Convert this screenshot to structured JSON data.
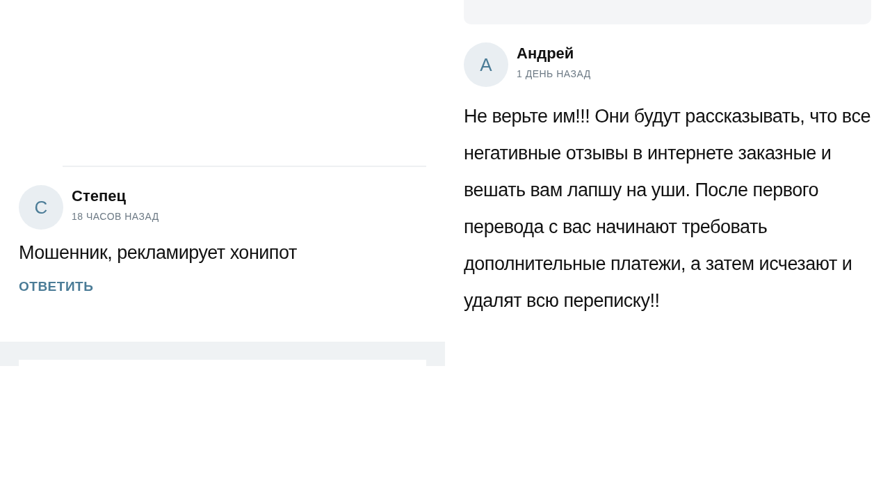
{
  "comments": [
    {
      "avatar_letter": "С",
      "author": "Степец",
      "time": "18 ЧАСОВ НАЗАД",
      "text": "Мошенник, рекламирует хонипот",
      "reply": "ОТВЕТИТЬ"
    },
    {
      "avatar_letter": "А",
      "author": "Андрей",
      "time": "1 ДЕНЬ НАЗАД",
      "text": "Не верьте им!!! Они будут рассказывать, что все негативные отзывы в интернете заказные и вешать вам лапшу на уши. После первого перевода с вас начинают требовать дополнительные платежи, а затем исчезают и удалят всю переписку!!"
    }
  ]
}
